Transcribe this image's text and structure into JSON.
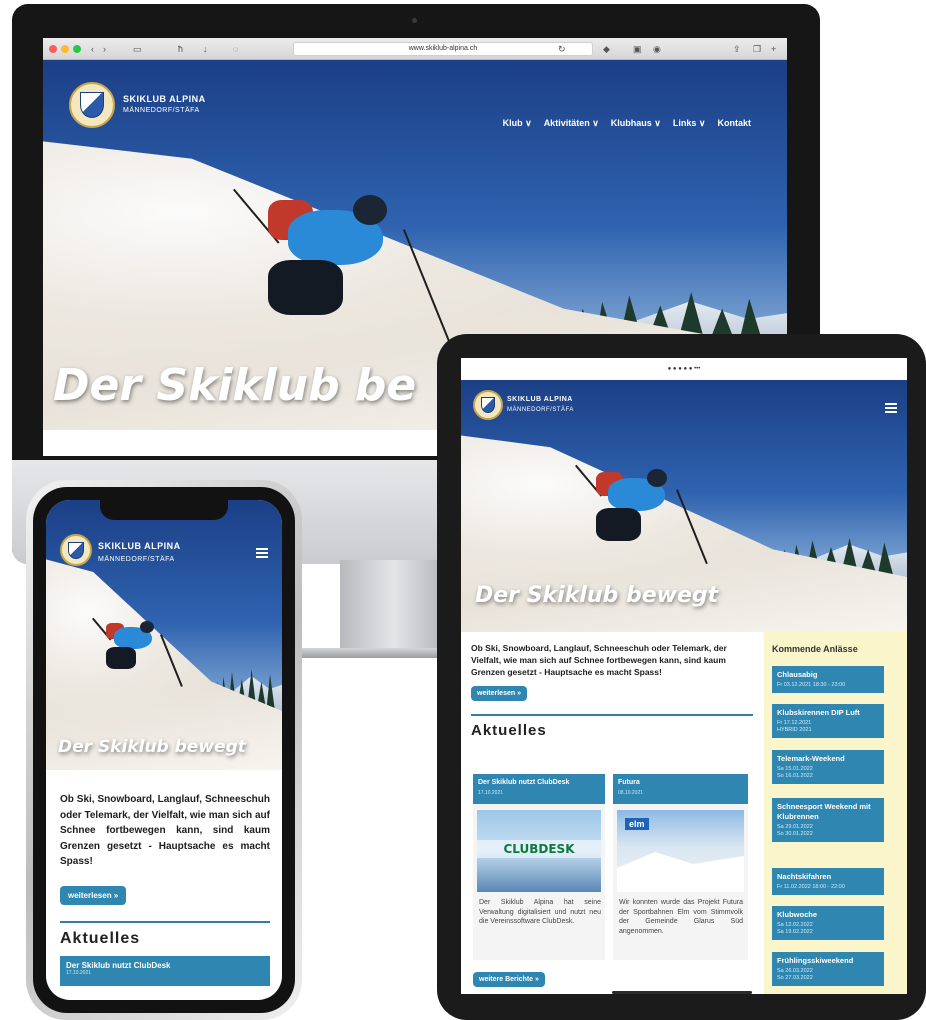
{
  "site": {
    "brand_line1": "SKIKLUB ALPINA",
    "brand_line2": "MÄNNEDORF/STÄFA",
    "hero_title": "Der Skiklub bewegt",
    "hero_title_desktop": "Der Skiklub be"
  },
  "browser": {
    "url": "www.skiklub-alpina.ch"
  },
  "desktop_nav": [
    "Klub ∨",
    "Aktivitäten ∨",
    "Klubhaus ∨",
    "Links ∨",
    "Kontakt"
  ],
  "tablet": {
    "status_text": "● ● ● ● ●  •••",
    "intro": "Ob Ski, Snowboard, Langlauf, Schneeschuh oder Telemark, der Vielfalt, wie man sich auf Schnee fortbewegen kann, sind kaum Grenzen gesetzt - Hauptsache es macht Spass!",
    "read_more": "weiterlesen »",
    "news_title": "Aktuelles",
    "news": [
      {
        "title": "Der Skiklub nutzt ClubDesk",
        "date": "17.10.2021",
        "image_label": "CLUBDESK",
        "text": "Der Skiklub Alpina hat seine Verwaltung digitalisiert und nutzt neu die Vereinssoftware ClubDesk."
      },
      {
        "title": "Futura",
        "date": "08.10.2021",
        "image_label": "elm",
        "text": "Wir konnten wurde das Projekt Futura der Sportbahnen Elm vom Stimmvolk der Gemeinde Glarus Süd angenommen."
      }
    ],
    "more_news": "weitere Berichte »",
    "sidebar_title": "Kommende Anlässe",
    "events": [
      {
        "title": "Chlausabig",
        "date": "Fr 03.12.2021 18:30 - 23:00"
      },
      {
        "title": "Klubskirennen DIP Luft",
        "date": "Fr 17.12.2021\nHYBRID 2021"
      },
      {
        "title": "Telemark-Weekend",
        "date": "Sa 15.01.2022\nSo 16.01.2022"
      },
      {
        "title": "Schneesport Weekend mit Klubrennen",
        "date": "Sa 29.01.2022\nSo 30.01.2022"
      },
      {
        "title": "Nachtskifahren",
        "date": "Fr 11.02.2022 18:00 - 22:00"
      },
      {
        "title": "Klubwoche",
        "date": "Sa 12.02.2022\nSa 19.02.2022"
      },
      {
        "title": "Frühlingsskiweekend",
        "date": "Sa 26.03.2022\nSo 27.03.2022"
      }
    ]
  },
  "phone": {
    "intro": "Ob Ski, Snowboard, Langlauf, Schneeschuh oder Telemark, der Vielfalt, wie man sich auf Schnee fortbewegen kann, sind kaum Grenzen gesetzt - Hauptsache es macht Spass!",
    "read_more": "weiterlesen »",
    "news_title": "Aktuelles",
    "first_news": "Der Skiklub nutzt ClubDesk",
    "first_news_date": "17.10.2021"
  },
  "colors": {
    "accent": "#2f87b1",
    "sidebar_bg": "#fbf5cc",
    "sky": "#1b3f86"
  },
  "icons": [
    "logo-badge",
    "hamburger-menu-icon",
    "chevron-down-icon",
    "browser-back-icon",
    "browser-share-icon"
  ]
}
